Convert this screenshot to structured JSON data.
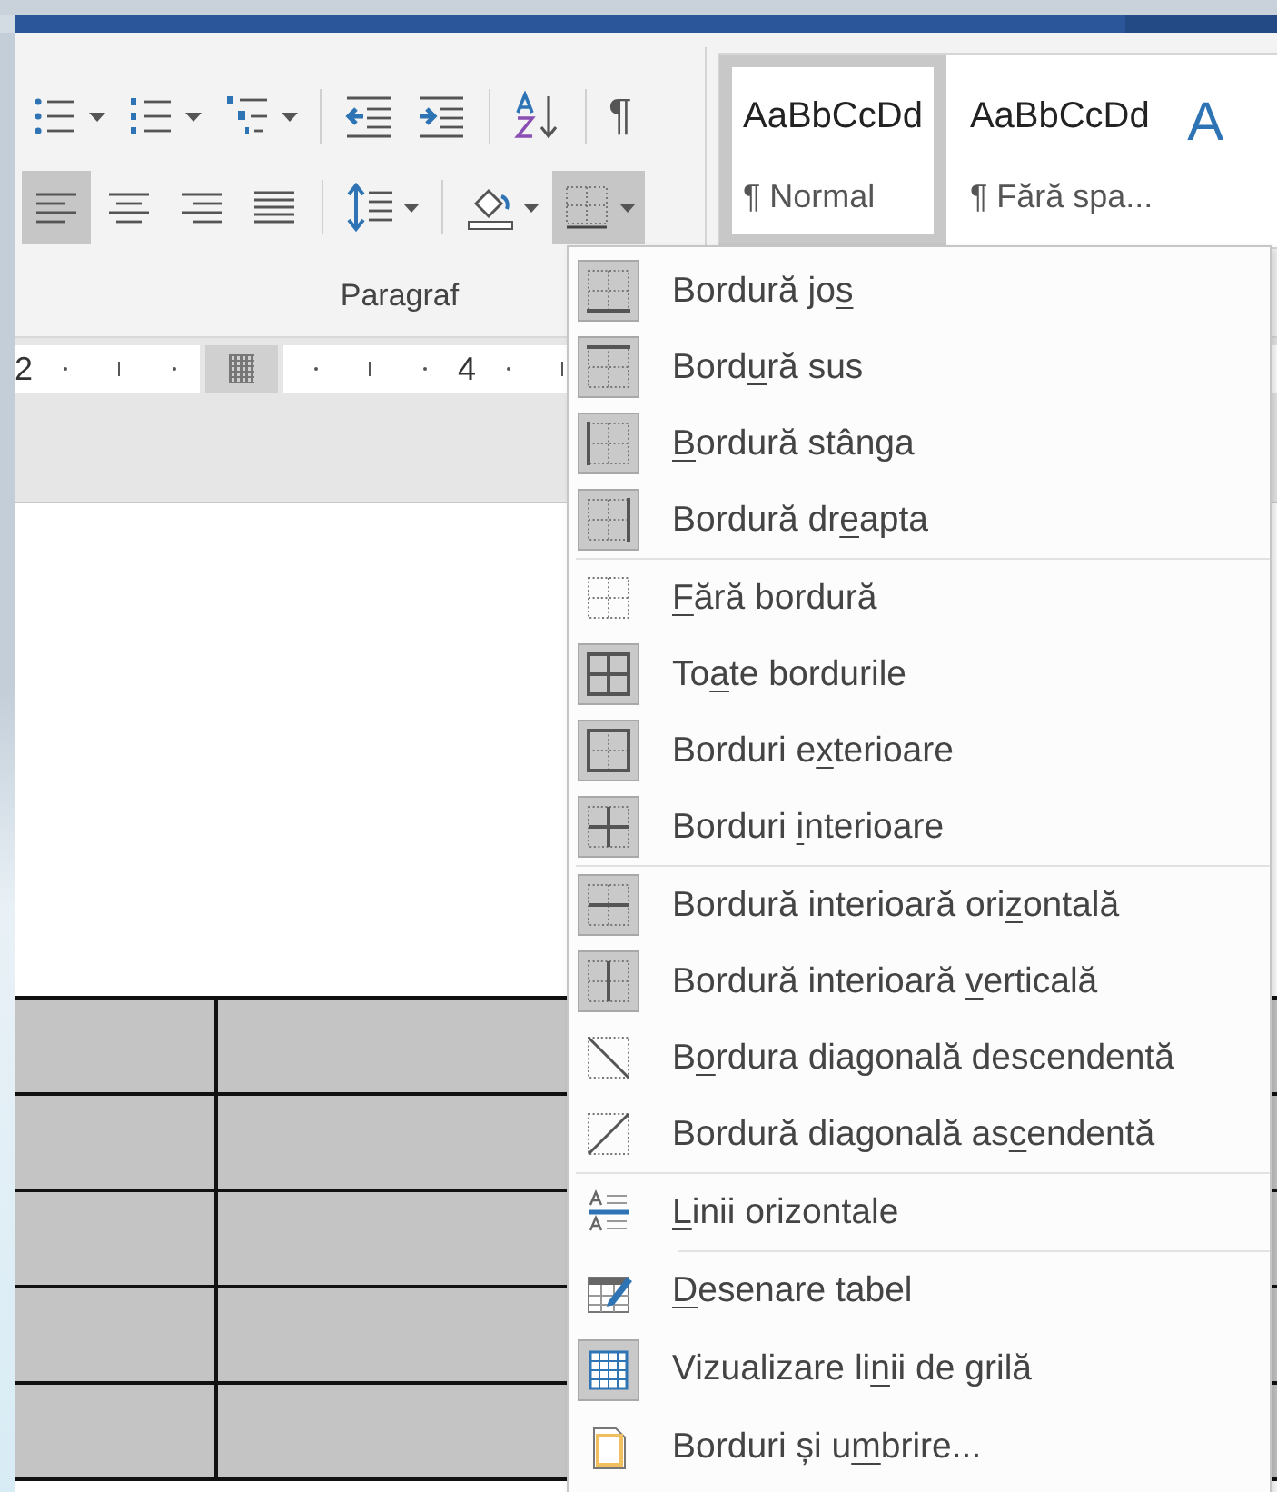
{
  "ribbon": {
    "paragraph_group": {
      "label": "Paragraf",
      "row_1": [
        {
          "kind": "bullets",
          "selected": false,
          "dropdown": true
        },
        {
          "kind": "numbering",
          "selected": false,
          "dropdown": true
        },
        {
          "kind": "multilevel",
          "selected": false,
          "dropdown": true
        },
        {
          "kind": "separator"
        },
        {
          "kind": "decrease_indent",
          "selected": false,
          "dropdown": false
        },
        {
          "kind": "increase_indent",
          "selected": false,
          "dropdown": false
        },
        {
          "kind": "separator"
        },
        {
          "kind": "sort",
          "selected": false,
          "dropdown": false
        },
        {
          "kind": "separator"
        },
        {
          "kind": "pilcrow",
          "text": "¶",
          "selected": false,
          "dropdown": false
        }
      ],
      "row_2": [
        {
          "kind": "align_left",
          "selected": true,
          "dropdown": false
        },
        {
          "kind": "align_center",
          "selected": false,
          "dropdown": false
        },
        {
          "kind": "align_right",
          "selected": false,
          "dropdown": false
        },
        {
          "kind": "justify",
          "selected": false,
          "dropdown": false
        },
        {
          "kind": "separator"
        },
        {
          "kind": "line_spacing",
          "selected": false,
          "dropdown": true
        },
        {
          "kind": "separator"
        },
        {
          "kind": "shading",
          "selected": false,
          "dropdown": true
        },
        {
          "kind": "borders",
          "selected": true,
          "dropdown": true
        }
      ]
    },
    "styles": [
      {
        "sample": "AaBbCcDd",
        "name": "¶ Normal",
        "selected": true
      },
      {
        "sample": "AaBbCcDd",
        "name": "¶ Fără spa...",
        "selected": false
      },
      {
        "sample": "A",
        "selected": false
      }
    ]
  },
  "ruler": {
    "labels": [
      "2",
      "4"
    ]
  },
  "borders_menu": {
    "groups": [
      {
        "items": [
          {
            "kind": "bottom",
            "checked": true,
            "before": "Bordură jo",
            "key": "s"
          },
          {
            "kind": "top",
            "checked": true,
            "before": "Bord",
            "key": "u",
            "after": "ră sus"
          },
          {
            "kind": "left",
            "checked": true,
            "key": "B",
            "after": "ordură stânga"
          },
          {
            "kind": "right",
            "checked": true,
            "before": "Bordură dr",
            "key": "e",
            "after": "apta"
          }
        ]
      },
      {
        "divider": true,
        "indented": false,
        "items": [
          {
            "kind": "none",
            "checked": false,
            "key": "F",
            "after": "ără bordură"
          },
          {
            "kind": "all",
            "checked": true,
            "before": "To",
            "key": "a",
            "after": "te bordurile"
          },
          {
            "kind": "outside",
            "checked": true,
            "before": "Borduri e",
            "key": "x",
            "after": "terioare"
          },
          {
            "kind": "inside",
            "checked": true,
            "before": "Borduri ",
            "key": "i",
            "after": "nterioare"
          }
        ]
      },
      {
        "divider": true,
        "indented": false,
        "items": [
          {
            "kind": "inside_h",
            "checked": true,
            "before": "Bordură interioară ori",
            "key": "z",
            "after": "ontală"
          },
          {
            "kind": "inside_v",
            "checked": true,
            "before": "Bordură interioară ",
            "key": "v",
            "after": "erticală"
          },
          {
            "kind": "diag_down",
            "checked": false,
            "before": "B",
            "key": "o",
            "after": "rdura diagonală descendentă"
          },
          {
            "kind": "diag_up",
            "checked": false,
            "before": "Bordură diagonală as",
            "key": "c",
            "after": "endentă"
          }
        ]
      },
      {
        "divider": true,
        "indented": false,
        "items": [
          {
            "kind": "hlines",
            "checked": false,
            "key": "L",
            "after": "inii orizontale"
          }
        ]
      },
      {
        "divider": true,
        "indented": true,
        "items": [
          {
            "kind": "draw_table",
            "checked": false,
            "key": "D",
            "after": "esenare tabel"
          },
          {
            "kind": "gridlines",
            "checked": true,
            "before": "Vizualizare li",
            "key": "n",
            "after": "ii de grilă"
          },
          {
            "kind": "borders_shading",
            "checked": false,
            "before": "Borduri și u",
            "key": "m",
            "after": "brire..."
          }
        ]
      }
    ]
  }
}
